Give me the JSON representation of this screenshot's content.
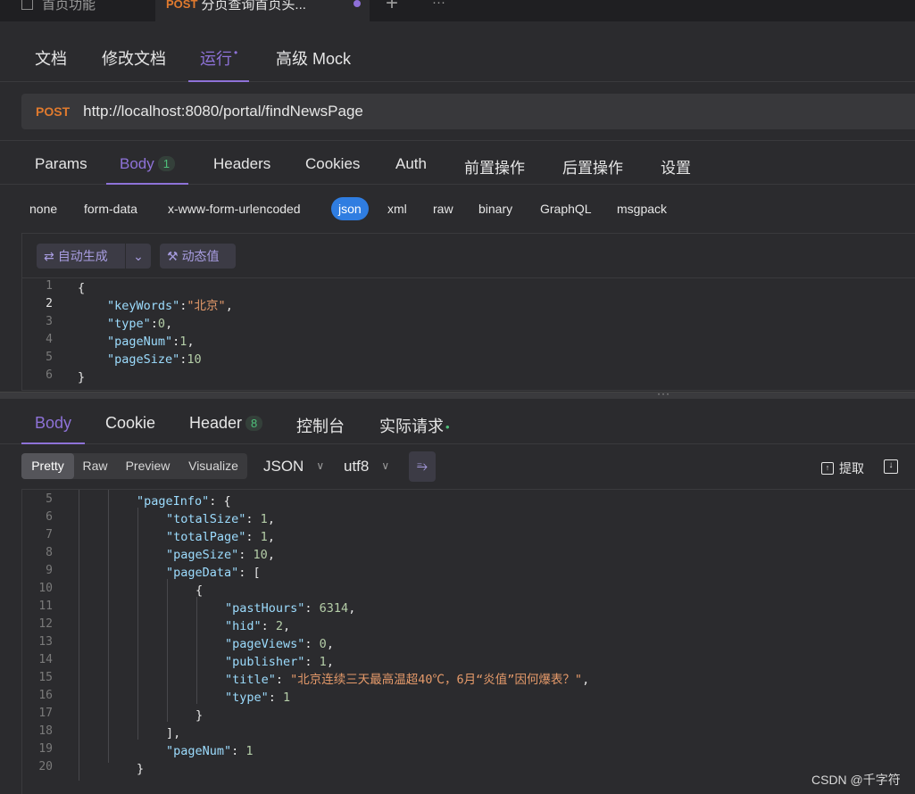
{
  "window_tabs": {
    "tab1_label": "首页功能",
    "tab2_method": "POST",
    "tab2_label": "分页查询首页头...",
    "plus": "+",
    "more": "···"
  },
  "doc_tabs": [
    "文档",
    "修改文档",
    "运行",
    "高级 Mock"
  ],
  "active_doc_tab_bullet": "•",
  "request": {
    "method": "POST",
    "url": "http://localhost:8080/portal/findNewsPage"
  },
  "request_tabs": [
    "Params",
    "Body",
    "Headers",
    "Cookies",
    "Auth",
    "前置操作",
    "后置操作",
    "设置"
  ],
  "body_badge": "1",
  "body_types": [
    "none",
    "form-data",
    "x-www-form-urlencoded",
    "json",
    "xml",
    "raw",
    "binary",
    "GraphQL",
    "msgpack"
  ],
  "editor_buttons": {
    "auto_generate": "自动生成",
    "dynamic_value": "动态值"
  },
  "request_body_lines": [
    {
      "num": "1",
      "text": "{"
    },
    {
      "num": "2",
      "key": "\"keyWords\"",
      "value": "\"北京\"",
      "suffix": ","
    },
    {
      "num": "3",
      "key": "\"type\"",
      "value": "0",
      "suffix": ","
    },
    {
      "num": "4",
      "key": "\"pageNum\"",
      "value": "1",
      "suffix": ","
    },
    {
      "num": "5",
      "key": "\"pageSize\"",
      "value": "10",
      "suffix": ""
    },
    {
      "num": "6",
      "text": "}"
    }
  ],
  "splitter_handle": "···",
  "response_tabs": [
    "Body",
    "Cookie",
    "Header",
    "控制台",
    "实际请求"
  ],
  "header_badge": "8",
  "response_view_modes": [
    "Pretty",
    "Raw",
    "Preview",
    "Visualize"
  ],
  "response_format": "JSON",
  "response_encoding": "utf8",
  "extract_label": "提取",
  "response_lines": [
    {
      "num": "5",
      "key": "\"pageInfo\"",
      "rest": ": {"
    },
    {
      "num": "6",
      "key": "\"totalSize\"",
      "value": "1",
      "suffix": ","
    },
    {
      "num": "7",
      "key": "\"totalPage\"",
      "value": "1",
      "suffix": ","
    },
    {
      "num": "8",
      "key": "\"pageSize\"",
      "value": "10",
      "suffix": ","
    },
    {
      "num": "9",
      "key": "\"pageData\"",
      "rest": ": ["
    },
    {
      "num": "10",
      "text": "{"
    },
    {
      "num": "11",
      "key": "\"pastHours\"",
      "value": "6314",
      "suffix": ","
    },
    {
      "num": "12",
      "key": "\"hid\"",
      "value": "2",
      "suffix": ","
    },
    {
      "num": "13",
      "key": "\"pageViews\"",
      "value": "0",
      "suffix": ","
    },
    {
      "num": "14",
      "key": "\"publisher\"",
      "value": "1",
      "suffix": ","
    },
    {
      "num": "15",
      "key": "\"title\"",
      "svalue": "\"北京连续三天最高温超40℃，6月“炎值”因何爆表？\"",
      "suffix": ","
    },
    {
      "num": "16",
      "key": "\"type\"",
      "value": "1",
      "suffix": ""
    },
    {
      "num": "17",
      "text": "}"
    },
    {
      "num": "18",
      "text": "],"
    },
    {
      "num": "19",
      "key": "\"pageNum\"",
      "value": "1",
      "suffix": ""
    },
    {
      "num": "20",
      "text": "}"
    }
  ],
  "watermark": "CSDN @千字符"
}
